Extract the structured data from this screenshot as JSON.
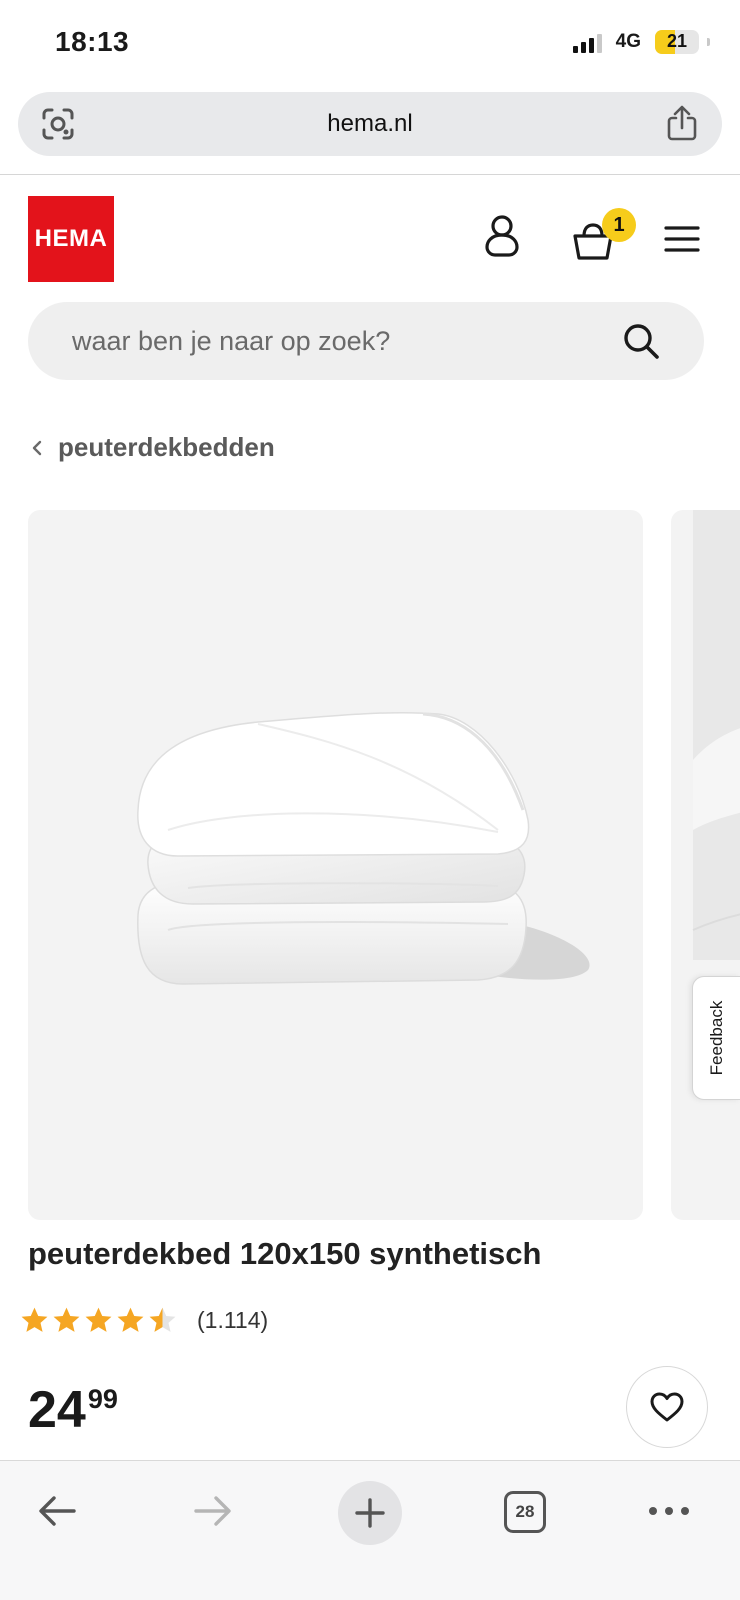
{
  "status_bar": {
    "time": "18:13",
    "network": "4G",
    "battery": "21",
    "battery_level_percent": 21
  },
  "browser": {
    "url": "hema.nl",
    "tab_count": "28",
    "icons": {
      "left": "lens-scan-icon",
      "share": "share-icon",
      "back": "back-arrow-icon",
      "forward": "forward-arrow-icon",
      "new_tab": "plus-icon",
      "tabs": "tabs-icon",
      "more": "more-dots-icon"
    }
  },
  "header": {
    "logo_text": "HEMA",
    "cart_count": "1",
    "colors": {
      "brand_red": "#e3131b",
      "badge_yellow": "#f6cc1b"
    },
    "icons": {
      "account": "account-icon",
      "cart": "basket-icon",
      "menu": "hamburger-menu-icon"
    }
  },
  "search": {
    "placeholder": "waar ben je naar op zoek?",
    "value": ""
  },
  "breadcrumb": {
    "label": "peuterdekbedden"
  },
  "product": {
    "title": "peuterdekbed 120x150 synthetisch",
    "rating_value": 4.5,
    "rating_max": 5,
    "rating_count": "(1.114)",
    "price_int": "24",
    "price_dec": "99",
    "star_color": "#f5a623"
  },
  "feedback": {
    "label": "Feedback"
  }
}
